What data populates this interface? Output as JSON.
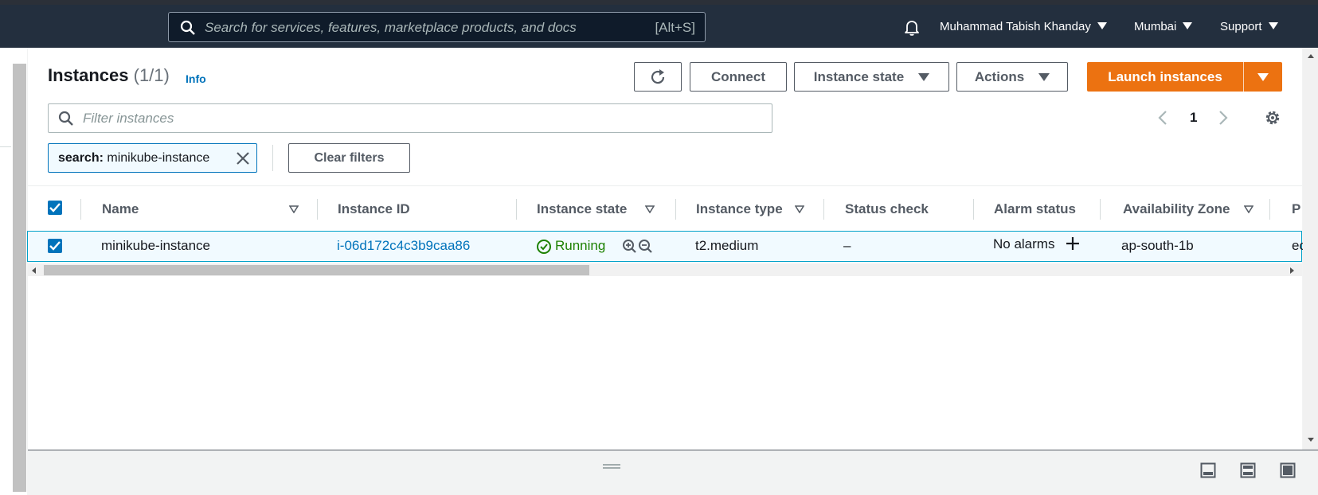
{
  "header": {
    "search_placeholder": "Search for services, features, marketplace products, and docs",
    "search_shortcut": "[Alt+S]",
    "user": "Muhammad Tabish Khanday",
    "region": "Mumbai",
    "support": "Support"
  },
  "page": {
    "title": "Instances",
    "count": "(1/1)",
    "info": "Info",
    "filter_placeholder": "Filter instances",
    "page_number": "1"
  },
  "toolbar": {
    "connect": "Connect",
    "instance_state": "Instance state",
    "actions": "Actions",
    "launch": "Launch instances"
  },
  "filter_token": {
    "key": "search:",
    "value": "minikube-instance"
  },
  "clear_filters": "Clear filters",
  "columns": [
    "Name",
    "Instance ID",
    "Instance state",
    "Instance type",
    "Status check",
    "Alarm status",
    "Availability Zone",
    "P"
  ],
  "rows": [
    {
      "name": "minikube-instance",
      "instance_id": "i-06d172c4c3b9caa86",
      "state": "Running",
      "type": "t2.medium",
      "status_check": "–",
      "alarm": "No alarms",
      "az": "ap-south-1b",
      "extra": "ec"
    }
  ],
  "colors": {
    "nav_bg": "#232f3e",
    "accent_orange": "#ec7211",
    "link_blue": "#0073bb",
    "running_green": "#1d8102"
  }
}
